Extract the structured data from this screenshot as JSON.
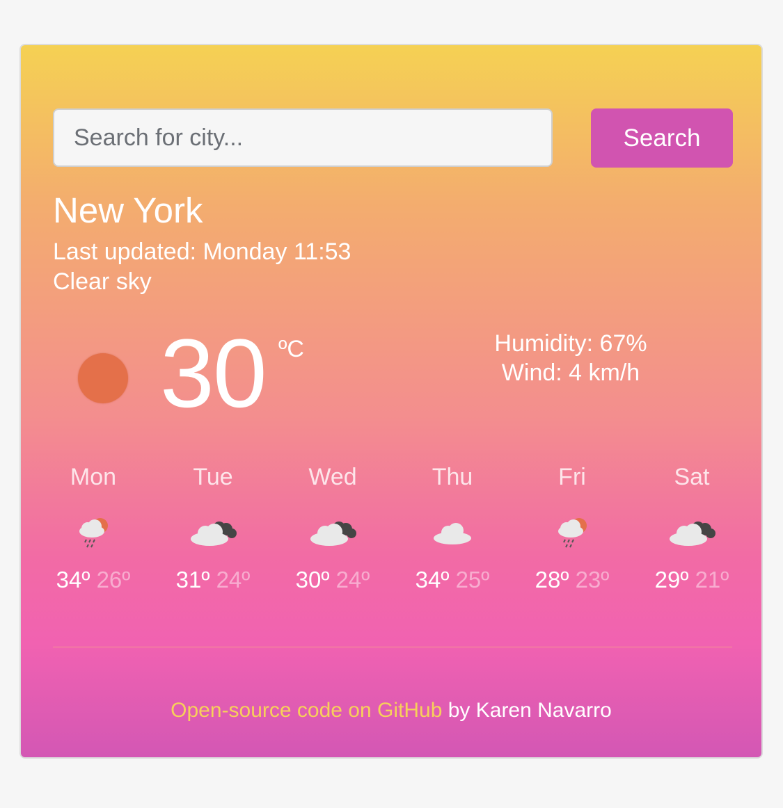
{
  "search": {
    "placeholder": "Search for city...",
    "button_label": "Search"
  },
  "current": {
    "city": "New York",
    "last_updated": "Last updated: Monday 11:53",
    "description": "Clear sky",
    "icon": "sun-icon",
    "temperature": "30",
    "unit": "ºC",
    "humidity": "Humidity: 67%",
    "wind": "Wind: 4 km/h"
  },
  "forecast": [
    {
      "day": "Mon",
      "icon": "rain-sun-icon",
      "max": "34º",
      "min": "26º"
    },
    {
      "day": "Tue",
      "icon": "broken-clouds-icon",
      "max": "31º",
      "min": "24º"
    },
    {
      "day": "Wed",
      "icon": "broken-clouds-icon",
      "max": "30º",
      "min": "24º"
    },
    {
      "day": "Thu",
      "icon": "cloud-icon",
      "max": "34º",
      "min": "25º"
    },
    {
      "day": "Fri",
      "icon": "rain-sun-icon",
      "max": "28º",
      "min": "23º"
    },
    {
      "day": "Sat",
      "icon": "broken-clouds-icon",
      "max": "29º",
      "min": "21º"
    }
  ],
  "footer": {
    "link_text": "Open-source code on GitHub",
    "suffix": " by Karen Navarro"
  },
  "colors": {
    "accent": "#d154b0",
    "sun": "#e4704a",
    "link": "#f7d05a"
  }
}
